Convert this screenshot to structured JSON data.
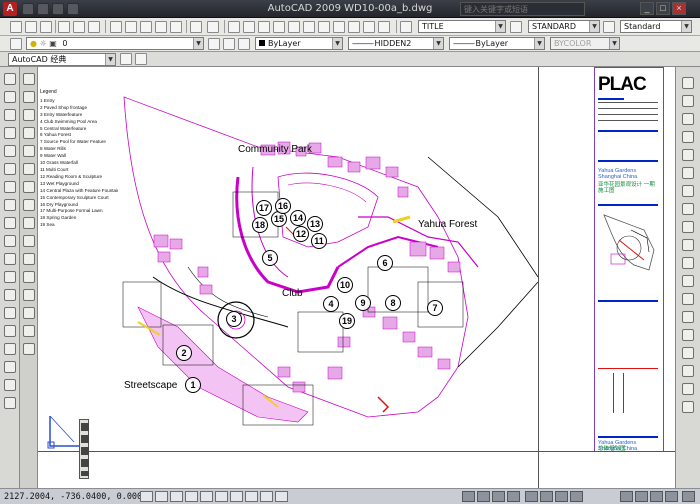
{
  "window": {
    "title": "AutoCAD 2009  WD10-00a_b.dwg",
    "search_placeholder": "键入关键字或短语",
    "logo": "A",
    "buttons": [
      "_",
      "□",
      "×"
    ]
  },
  "toolbar": {
    "text_style": "TITLE",
    "dim_style": "STANDARD",
    "table_style": "Standard"
  },
  "layer_bar": {
    "current_layer": "0",
    "color": "ByLayer",
    "linetype": "HIDDEN2",
    "lineweight": "ByLayer",
    "plot_style": "BYCOLOR"
  },
  "workspace": {
    "name": "AutoCAD 经典"
  },
  "drawing": {
    "labels": {
      "community_park": "Community Park",
      "yahua_forest": "Yahua Forest",
      "club": "Club",
      "streetscape": "Streetscape"
    },
    "zones": [
      "1",
      "2",
      "3",
      "4",
      "5",
      "6",
      "7",
      "8",
      "9",
      "10",
      "11",
      "12",
      "13",
      "14",
      "15",
      "16",
      "17",
      "18",
      "19"
    ],
    "legend_title": "Legend",
    "legend": [
      "1  Entry",
      "2  Paved Shop frontage",
      "3  Entry Waterfeature",
      "4  Club Swimming Pool Area",
      "5  Central Waterfeature",
      "6  Yahua Forest",
      "7  Source Pool for Water Feature",
      "8  Water Rills",
      "9  Water Wall",
      "10 Grass Waterfall",
      "11 Multi Court",
      "12 Reading Room & Sculpture",
      "13 Wet Playground",
      "14 Central Plaza with Feature Fountains",
      "15 Contemporary Sculpture Court",
      "16 Dry Playground",
      "17 Multi-Purpose Formal Lawn",
      "18 Spring Garden",
      "19 Sea"
    ]
  },
  "title_block": {
    "logo": "PLAC",
    "company_en": "Yahua Gardens Shanghai China",
    "company_zh": "亚华花园景观设计 一期施工图",
    "footer_en": "Yahua Gardens Shanghai China",
    "footer_zh": "总体规划图"
  },
  "status": {
    "coordinates": "2127.2004, -736.0400, 0.0000"
  },
  "colors": {
    "plan_lines": "#c800c8",
    "background": "#ffffff",
    "title_bar": "#2b2e34",
    "accent_blue": "#0026c9",
    "accent_green": "#0a8a3a"
  }
}
